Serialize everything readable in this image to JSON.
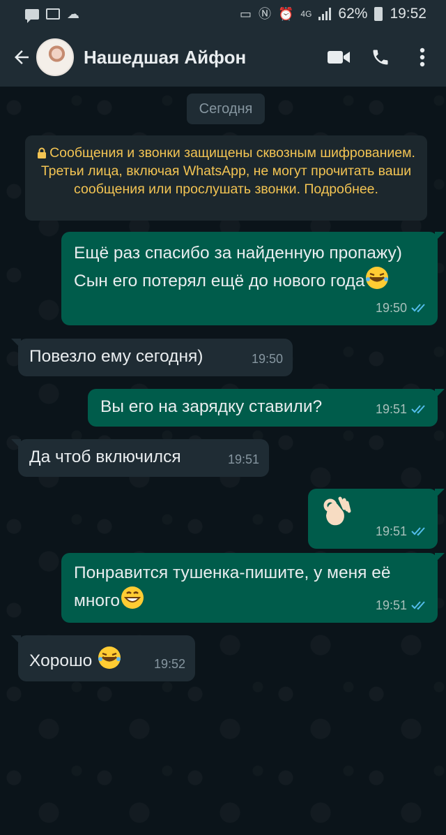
{
  "status_bar": {
    "battery": "62%",
    "time": "19:52",
    "network": "4G"
  },
  "header": {
    "contact_name": "Нашедшая Айфон",
    "icons": [
      "back-arrow-icon",
      "video-call-icon",
      "phone-icon",
      "more-vert-icon"
    ]
  },
  "chat": {
    "date_label": "Сегодня",
    "encryption_notice": "Сообщения и звонки защищены сквозным шифрованием. Третьи лица, включая WhatsApp, не могут прочитать ваши сообщения или прослушать звонки. Подробнее.",
    "messages": [
      {
        "direction": "out",
        "text": "Ещё раз спасибо за найденную пропажу) Сын его потерял ещё до нового года",
        "emoji": "rolling-laughing",
        "time": "19:50",
        "read": true
      },
      {
        "direction": "in",
        "text": "Повезло ему сегодня)",
        "time": "19:50"
      },
      {
        "direction": "out",
        "text": "Вы его на зарядку ставили?",
        "time": "19:51",
        "read": true
      },
      {
        "direction": "in",
        "text": "Да чтоб включился",
        "time": "19:51"
      },
      {
        "direction": "out",
        "text": "",
        "emoji": "ok-hand",
        "time": "19:51",
        "read": true
      },
      {
        "direction": "out",
        "text": "Понравится тушенка-пишите, у меня её много",
        "emoji": "grinning",
        "time": "19:51",
        "read": true
      },
      {
        "direction": "in",
        "text": "Хорошо",
        "emoji": "rolling-laughing",
        "time": "19:52"
      }
    ]
  },
  "colors": {
    "header_bg": "#1f2c34",
    "chat_bg": "#0b141a",
    "outgoing_bubble": "#005c4b",
    "incoming_bubble": "#1f2c34",
    "notice_text": "#f3c453",
    "read_check": "#53bdeb"
  }
}
